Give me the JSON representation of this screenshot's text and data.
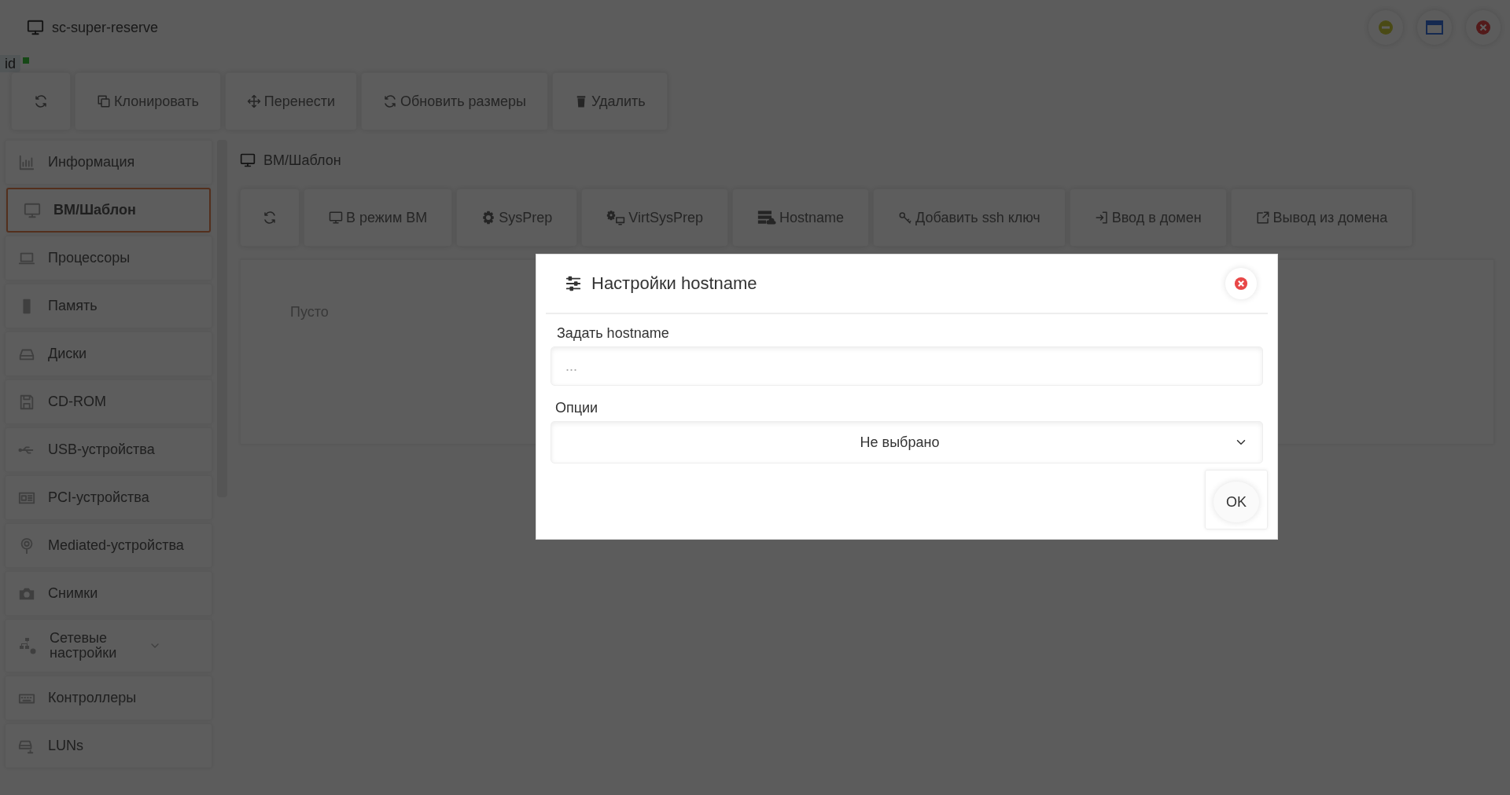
{
  "window": {
    "title": "sc-super-reserve"
  },
  "id_badge": {
    "label": "id"
  },
  "toolbar": {
    "buttons": [
      {
        "kind": "icon"
      },
      {
        "kind": "text",
        "label": "Клонировать"
      },
      {
        "kind": "text",
        "label": "Перенести"
      },
      {
        "kind": "text",
        "label": "Обновить размеры"
      },
      {
        "kind": "text",
        "label": "Удалить"
      }
    ]
  },
  "sidebar": {
    "items": [
      {
        "kind": "link",
        "label": "Информация",
        "selected": false
      },
      {
        "kind": "link",
        "label": "ВМ/Шаблон",
        "selected": true
      },
      {
        "kind": "link",
        "label": "Процессоры",
        "selected": false
      },
      {
        "kind": "link",
        "label": "Память",
        "selected": false
      },
      {
        "kind": "link",
        "label": "Диски",
        "selected": false
      },
      {
        "kind": "link",
        "label": "CD-ROM",
        "selected": false
      },
      {
        "kind": "link",
        "label": "USB-устройства",
        "selected": false
      },
      {
        "kind": "link",
        "label": "PCI-устройства",
        "selected": false
      },
      {
        "kind": "link",
        "label": "Mediated-устройства",
        "selected": false
      },
      {
        "kind": "link",
        "label": "Снимки",
        "selected": false
      },
      {
        "kind": "group",
        "label": "Сетевые настройки",
        "selected": false
      },
      {
        "kind": "link",
        "label": "Контроллеры",
        "selected": false
      },
      {
        "kind": "link",
        "label": "LUNs",
        "selected": false
      }
    ]
  },
  "content": {
    "breadcrumb": "ВМ/Шаблон",
    "toolbar": {
      "buttons": [
        {
          "kind": "icon"
        },
        {
          "kind": "text",
          "label": "В режим ВМ"
        },
        {
          "kind": "text",
          "label": "SysPrep"
        },
        {
          "kind": "text",
          "label": "VirtSysPrep"
        },
        {
          "kind": "text",
          "label": "Hostname"
        },
        {
          "kind": "text",
          "label": "Добавить ssh ключ"
        },
        {
          "kind": "text",
          "label": "Ввод в домен"
        },
        {
          "kind": "text",
          "label": "Вывод из домена"
        }
      ]
    },
    "empty_text": "Пусто"
  },
  "dialog": {
    "title": "Настройки hostname",
    "fields": [
      {
        "kind": "text",
        "label": "Задать hostname",
        "placeholder": "..."
      },
      {
        "kind": "select",
        "label": "Опции",
        "value": "Не выбрано"
      }
    ],
    "ok_button": "OK"
  }
}
